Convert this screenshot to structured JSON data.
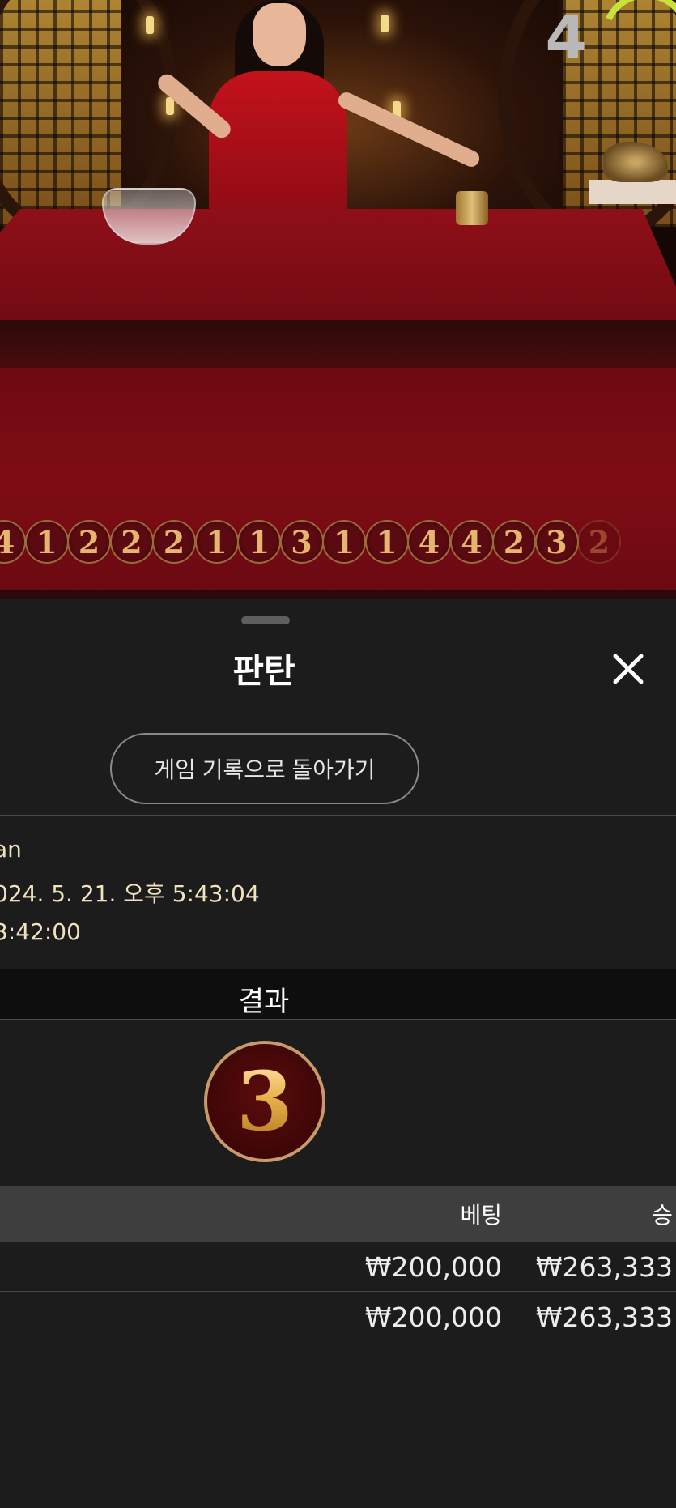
{
  "video": {
    "round_timer": "4"
  },
  "history_road": [
    "4",
    "1",
    "2",
    "2",
    "2",
    "1",
    "1",
    "3",
    "1",
    "1",
    "4",
    "4",
    "2",
    "3",
    "2"
  ],
  "sheet": {
    "title": "판탄",
    "back_button_label": "게임 기록으로 돌아가기",
    "info": {
      "game_name": "an",
      "datetime": "024. 5. 21. 오후 5:43:04",
      "time": "3:42:00"
    },
    "result_heading": "결과",
    "result_value": "3",
    "bets_table": {
      "columns": {
        "bet": "베팅",
        "win": "승"
      },
      "rows": [
        {
          "bet": "₩200,000",
          "win": "₩263,333"
        },
        {
          "bet": "₩200,000",
          "win": "₩263,333"
        }
      ]
    }
  }
}
